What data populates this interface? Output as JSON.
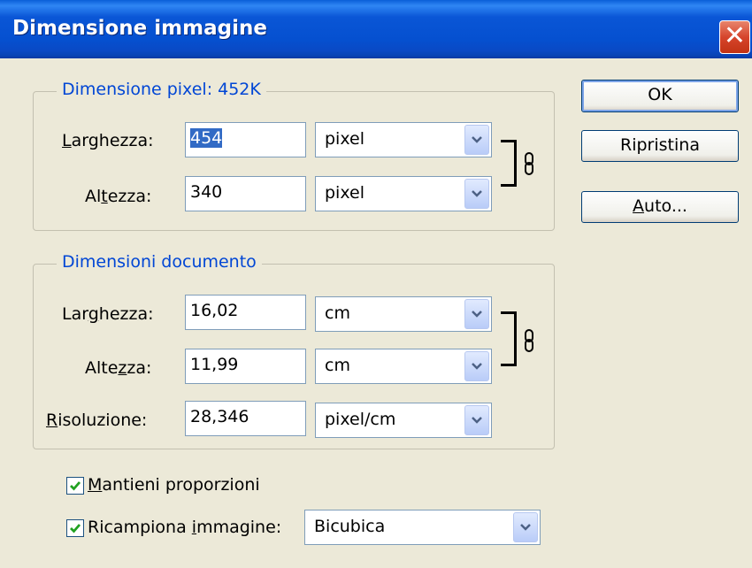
{
  "window": {
    "title": "Dimensione immagine",
    "close_glyph": "✕"
  },
  "pixel_dimensions": {
    "legend": "Dimensione pixel:  452K",
    "width_label_pre": "",
    "width_label_u": "L",
    "width_label_post": "arghezza:",
    "width_value": "454",
    "width_unit": "pixel",
    "height_label_pre": "Al",
    "height_label_u": "t",
    "height_label_post": "ezza:",
    "height_value": "340",
    "height_unit": "pixel"
  },
  "document_size": {
    "legend": "Dimensioni documento",
    "width_label_pre": "Lar",
    "width_label_u": "g",
    "width_label_post": "hezza:",
    "width_value": "16,02",
    "width_unit": "cm",
    "height_label_pre": "Alte",
    "height_label_u": "z",
    "height_label_post": "za:",
    "height_value": "11,99",
    "height_unit": "cm",
    "res_label_pre": "",
    "res_label_u": "R",
    "res_label_post": "isoluzione:",
    "res_value": "28,346",
    "res_unit": "pixel/cm"
  },
  "options": {
    "constrain_pre": "",
    "constrain_u": "M",
    "constrain_post": "antieni proporzioni",
    "constrain_checked": true,
    "resample_pre": "Ricampiona ",
    "resample_u": "i",
    "resample_post": "mmagine:",
    "resample_checked": true,
    "resample_method": "Bicubica"
  },
  "buttons": {
    "ok": "OK",
    "reset": "Ripristina",
    "auto_u": "A",
    "auto_post": "uto..."
  },
  "colors": {
    "titlebar": "#0a56d6",
    "legend": "#0046d5",
    "face": "#ece9d8",
    "selection": "#316ac5"
  }
}
